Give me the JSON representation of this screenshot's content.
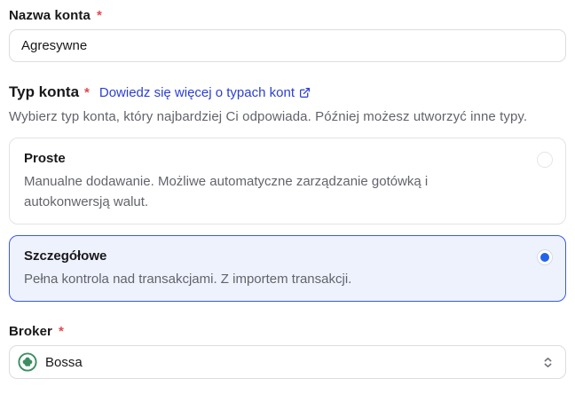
{
  "account_name": {
    "label": "Nazwa konta",
    "required_marker": "*",
    "value": "Agresywne"
  },
  "account_type": {
    "label": "Typ konta",
    "required_marker": "*",
    "learn_more_link": "Dowiedz się więcej o typach kont",
    "description": "Wybierz typ konta, który najbardziej Ci odpowiada. Później możesz utworzyć inne typy.",
    "options": [
      {
        "title": "Proste",
        "description": "Manualne dodawanie. Możliwe automatyczne zarządzanie gotówką i autokonwersją walut.",
        "selected": false
      },
      {
        "title": "Szczegółowe",
        "description": "Pełna kontrola nad transakcjami. Z importem transakcji.",
        "selected": true
      }
    ]
  },
  "broker": {
    "label": "Broker",
    "required_marker": "*",
    "selected_value": "Bossa",
    "icon": "bossa-logo-icon"
  },
  "icons": {
    "external_link": "external-link-icon",
    "select_chevrons": "chevron-up-down-icon"
  },
  "colors": {
    "accent_border": "#3b5ae8",
    "radio_dot": "#2563eb",
    "selected_card_bg": "#eef2fd",
    "link": "#2b3fd3",
    "required": "#e5484d",
    "logo_green": "#3c8e62",
    "text_muted": "#62646c"
  }
}
